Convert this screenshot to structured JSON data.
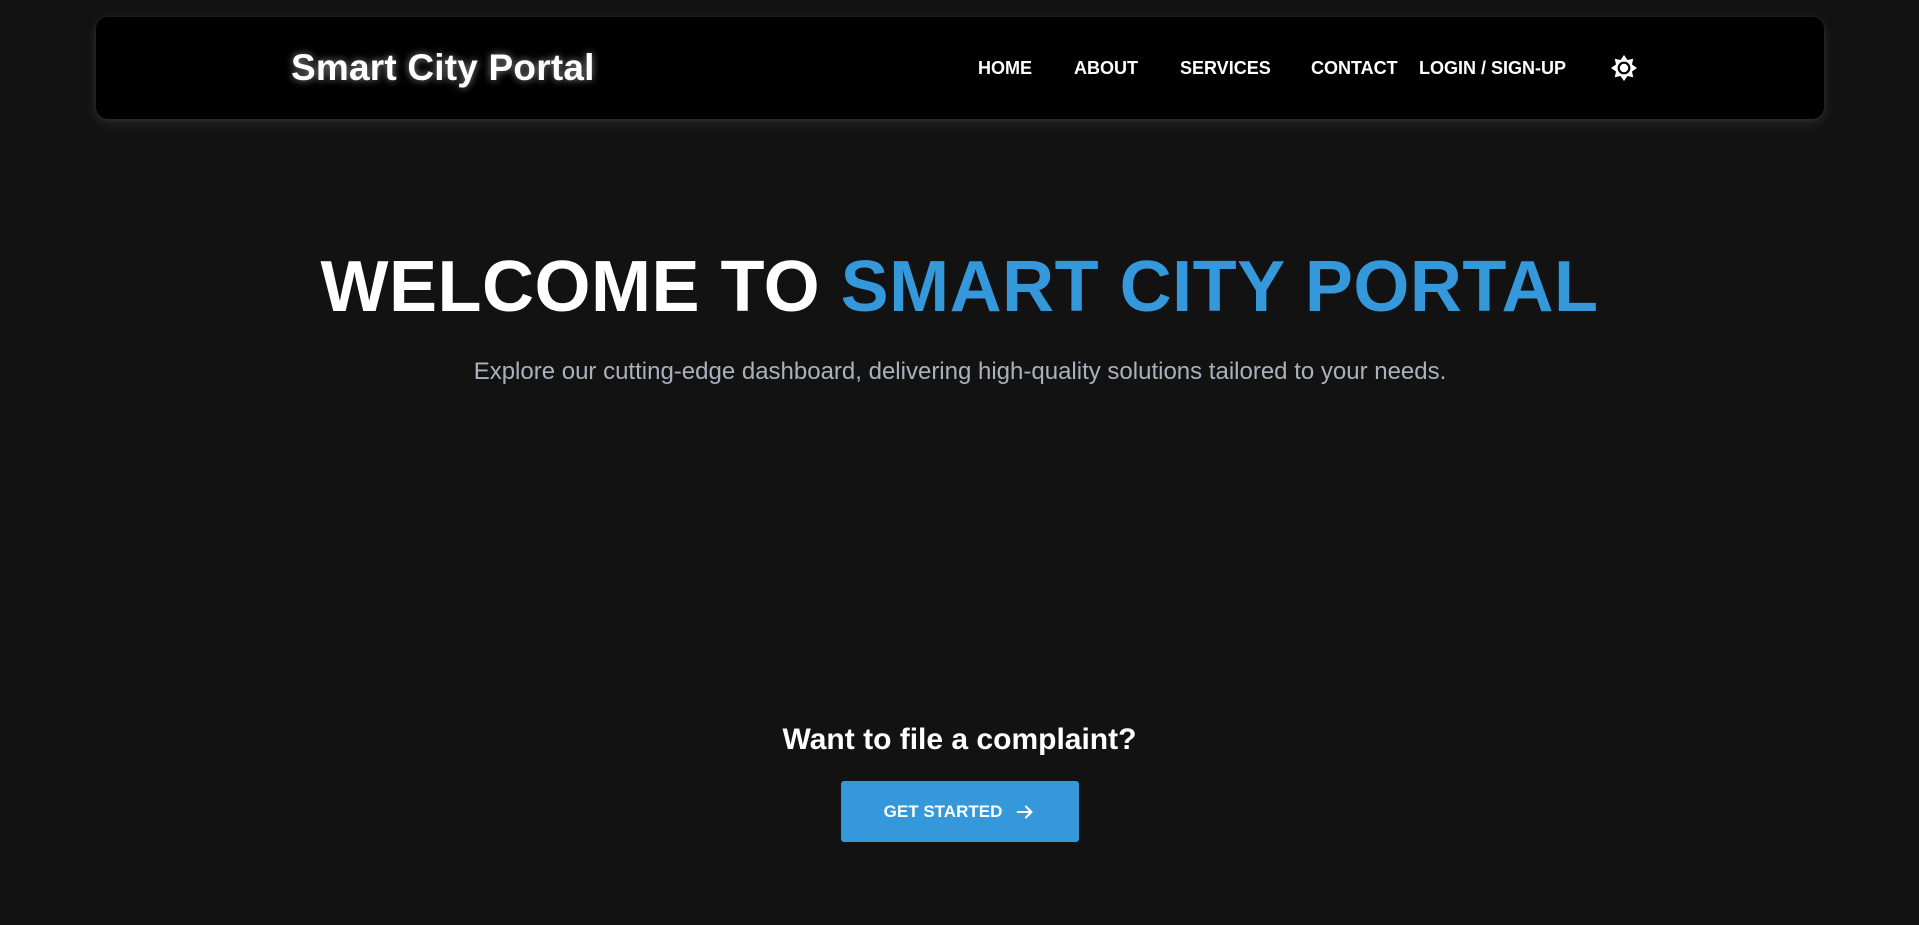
{
  "header": {
    "brand": "Smart City Portal",
    "nav": {
      "home": "HOME",
      "about": "ABOUT",
      "services": "SERVICES",
      "contact": "CONTACT",
      "login": "LOGIN / SIGN-UP"
    },
    "theme_toggle_icon": "sun-icon"
  },
  "hero": {
    "title_prefix": "WELCOME TO ",
    "title_accent": "SMART CITY PORTAL",
    "subtitle": "Explore our cutting-edge dashboard, delivering high-quality solutions tailored to your needs."
  },
  "cta": {
    "heading": "Want to file a complaint?",
    "button_label": "GET STARTED",
    "button_icon": "arrow-right-icon"
  },
  "colors": {
    "background": "#121212",
    "navbar": "#000000",
    "accent": "#3498db",
    "subtitle_text": "#a9b1bd"
  }
}
